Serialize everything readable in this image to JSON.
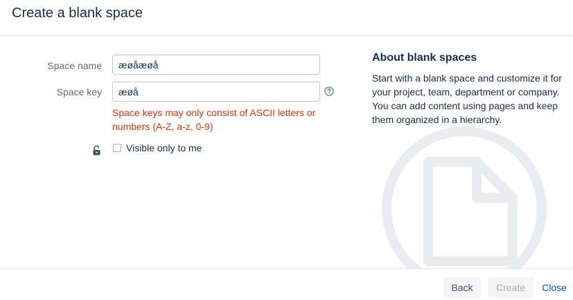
{
  "dialog": {
    "title": "Create a blank space"
  },
  "form": {
    "space_name": {
      "label": "Space name",
      "value": "æøåæøå"
    },
    "space_key": {
      "label": "Space key",
      "value": "æøå"
    },
    "space_key_error": "Space keys may only consist of ASCII letters or numbers (A-Z, a-z, 0-9)",
    "visible_only_to_me": {
      "label": "Visible only to me",
      "checked": false
    }
  },
  "about": {
    "title": "About blank spaces",
    "text": "Start with a blank space and customize it for your project, team, department or company. You can add content using pages and keep them organized in a hierarchy."
  },
  "footer": {
    "back_label": "Back",
    "create_label": "Create",
    "close_label": "Close"
  },
  "colors": {
    "error": "#de350b",
    "link": "#0052cc",
    "illustration": "#ebecf0"
  },
  "icons": [
    "help-icon",
    "lock-icon",
    "blank-page-illustration"
  ]
}
